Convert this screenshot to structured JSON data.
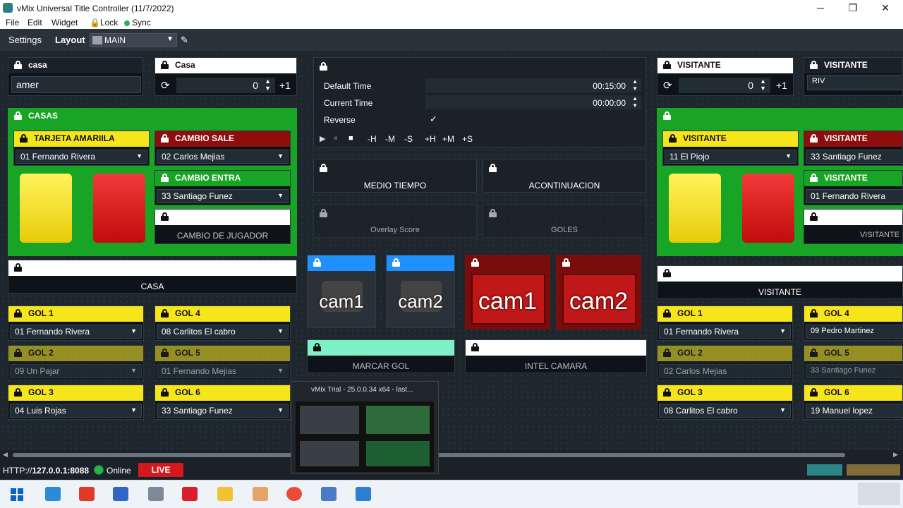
{
  "window": {
    "title": "vMix Universal Title Controller (11/7/2022)",
    "minimize": "─",
    "maximize": "❐",
    "close": "✕"
  },
  "menu": {
    "file": "File",
    "edit": "Edit",
    "widget": "Widget",
    "lock": "Lock",
    "sync": "Sync"
  },
  "toolbar": {
    "settings": "Settings",
    "layout": "Layout",
    "layout_value": "MAIN",
    "edit_icon": "pencil-icon"
  },
  "home": {
    "name_title": "casa",
    "name_value": "amer",
    "score_title": "Casa",
    "score_value": "0",
    "score_inc": "+1",
    "group_title": "CASAS",
    "yellow_title": "TARJETA AMARIILA",
    "yellow_value": "01 Fernando Rivera",
    "sub_out_title": "CAMBIO SALE",
    "sub_out_value": "02 Carlos Mejias",
    "sub_in_title": "CAMBIO ENTRA",
    "sub_in_value": "33 Santiago Funez",
    "sub_button": "CAMBIO DE JUGADOR",
    "team_button": "CASA",
    "goals": [
      {
        "title": "GOL 1",
        "value": "01 Fernando Rivera"
      },
      {
        "title": "GOL 4",
        "value": "08 Carlitos El cabro"
      },
      {
        "title": "GOL 2",
        "value": "09 Un Pajar"
      },
      {
        "title": "GOL 5",
        "value": "01 Fernando Mejias"
      },
      {
        "title": "GOL 3",
        "value": "04 Luis Rojas"
      },
      {
        "title": "GOL 6",
        "value": "33 Santiago Funez"
      }
    ]
  },
  "timer": {
    "default_label": "Default Time",
    "default_value": "00:15:00",
    "current_label": "Current Time",
    "current_value": "00:00:00",
    "reverse_label": "Reverse",
    "reverse_check": "✓",
    "controls": [
      "▶",
      "⏸",
      "■",
      "-H",
      "-M",
      "-S",
      "+H",
      "+M",
      "+S"
    ]
  },
  "center": {
    "half_time": "MEDIO TIEMPO",
    "next": "ACONTINUACION",
    "overlay_score": "Overlay Score",
    "goals_btn": "GOLES",
    "cams": [
      "cam1",
      "cam2",
      "cam1",
      "cam2"
    ],
    "mark_goal": "MARCAR GOL",
    "intel_camera": "INTEL CAMARA"
  },
  "away": {
    "score_title": "VISITANTE",
    "score_value": "0",
    "score_inc": "+1",
    "name_title": "VISITANTE",
    "name_value": "RIV",
    "yellow_title": "VISITANTE",
    "yellow_value": "11 El Piojo",
    "sub_out_title": "VISITANTE",
    "sub_out_value": "33 Santiago Funez",
    "sub_in_title": "VISITANTE",
    "sub_in_value": "01 Fernando Rivera",
    "sub_button": "VISITANTE",
    "team_button": "VISITANTE",
    "goals": [
      {
        "title": "GOL 1",
        "value": "01 Fernando Rivera"
      },
      {
        "title": "GOL 4",
        "value": "09 Pedro Martinez"
      },
      {
        "title": "GOL 2",
        "value": "02 Carlos Mejias"
      },
      {
        "title": "GOL 5",
        "value": "33 Santiago Funez"
      },
      {
        "title": "GOL 3",
        "value": "08 Carlitos El cabro"
      },
      {
        "title": "GOL 6",
        "value": "19 Manuel lopez"
      }
    ]
  },
  "status": {
    "url_prefix": "HTTP://",
    "url_host": "127.0.0.1:8088",
    "online": "Online",
    "live": "LIVE"
  },
  "thumbnail": {
    "title": "vMix Trial - 25.0.0.34 x64 - last..."
  },
  "colors": {
    "yellow": "#f7e51b",
    "red": "#8f0d0d",
    "green": "#18a526",
    "blue": "#1e90ff",
    "live": "#d4181b"
  }
}
